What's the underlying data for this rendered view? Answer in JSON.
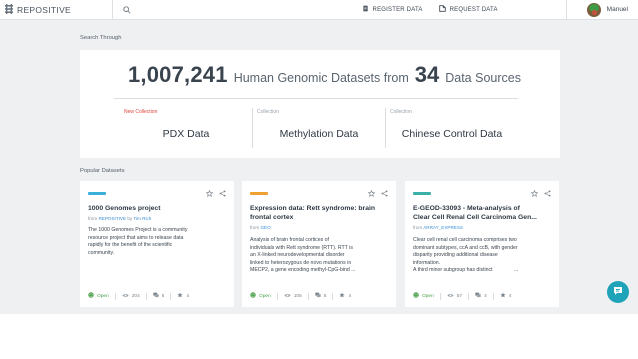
{
  "brand": {
    "name": "REPOSITIVE"
  },
  "search": {
    "placeholder": "",
    "value": ""
  },
  "nav": {
    "register_label": "REGISTER DATA",
    "request_label": "REQUEST DATA",
    "user_name": "Manuel"
  },
  "search_through": {
    "label": "Search Through",
    "count": "1,007,241",
    "text": "Human Genomic Datasets from",
    "sources_count": "34",
    "sources_text": "Data Sources",
    "collections": [
      {
        "tag": "New Collection",
        "title": "PDX Data"
      },
      {
        "tag": "Collection",
        "title": "Methylation Data"
      },
      {
        "tag": "Collection",
        "title": "Chinese Control Data"
      }
    ]
  },
  "popular": {
    "label": "Popular Datasets",
    "cards": [
      {
        "color": "#3ab0d8",
        "title_lines": [
          "1000 Genomes project"
        ],
        "meta_prefix": "from",
        "source": "REPOSITIVE",
        "by": "by",
        "author": "Tim Rich",
        "desc_lines": [
          "The 1000 Genomes Project is a community",
          "resource project that aims to release data",
          "rapidly for the benefit of the scientific",
          "community."
        ],
        "status": "Open",
        "views": "204",
        "comments": "6",
        "stars": "4"
      },
      {
        "color": "#f0a030",
        "title_lines": [
          "Expression data: Rett syndrome: brain",
          "frontal cortex"
        ],
        "meta_prefix": "from",
        "source": "GEO",
        "by": "",
        "author": "",
        "desc_lines": [
          "Analysis of brain frontal cortices of",
          "individuals with Rett syndrome (RTT). RTT is",
          "an X-linked neurodevelopmental disorder",
          "linked to heterozygous de novo mutations in",
          "MECP2, a gene encoding methyl-CpG-bind"
        ],
        "desc_more": "...",
        "status": "Open",
        "views": "105",
        "comments": "5",
        "stars": "4"
      },
      {
        "color": "#3ab0a8",
        "title_lines": [
          "E-GEOD-33093 - Meta-analysis of",
          "Clear Cell Renal Cell Carcinoma Gen..."
        ],
        "meta_prefix": "from",
        "source": "ARRAY_EXPRESS",
        "by": "",
        "author": "",
        "desc_lines": [
          "Clear cell renal cell carcinoma comprises two",
          "dominant subtypes, ccA and ccB, with gender",
          "disparity providing additional disease",
          "information.",
          "A third minor subgroup has distinct"
        ],
        "desc_more": "...",
        "status": "Open",
        "views": "57",
        "comments": "4",
        "stars": "4"
      }
    ]
  },
  "icons": {
    "brand": "repositive-logo-icon",
    "search": "search-icon",
    "register": "register-data-icon",
    "request": "request-data-icon",
    "star": "star-icon",
    "share": "share-icon",
    "open": "globe-icon",
    "views": "eye-icon",
    "comments": "comments-icon",
    "stars": "star-icon",
    "help": "help-chat-icon"
  },
  "colors": {
    "accent": "#3a8fd6",
    "new_tag": "#e0443c",
    "open": "#4aa04a",
    "fab": "#1fa3b8",
    "background": "#eef0f2"
  }
}
